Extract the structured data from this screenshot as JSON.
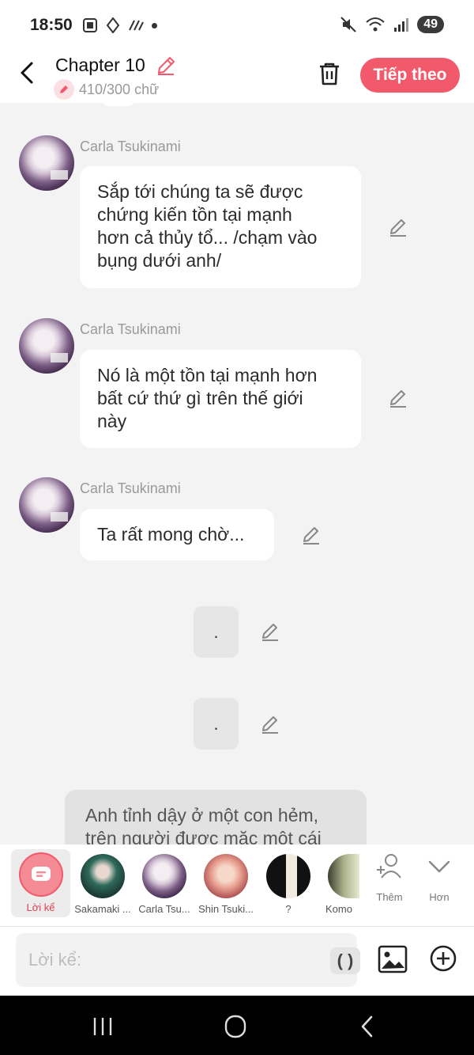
{
  "status": {
    "time": "18:50",
    "battery": "49",
    "left_icons": [
      "screenshot-icon",
      "signal-app-icon",
      "network-icon",
      "dot-icon"
    ],
    "right_icons": [
      "mute-icon",
      "wifi-icon",
      "cell-signal-icon"
    ]
  },
  "header": {
    "title": "Chapter 10",
    "counter": "410/300 chữ",
    "next_label": "Tiếp theo"
  },
  "messages": [
    {
      "sender": "Carla Tsukinami",
      "lines": [
        "Sắp tới chúng ta sẽ được",
        "chứng kiến tồn tại mạnh",
        "hơn cả thủy tổ... /chạm vào",
        "bụng dưới anh/"
      ]
    },
    {
      "sender": "Carla Tsukinami",
      "lines": [
        "Nó là một tồn tại mạnh hơn",
        "bất cứ thứ gì trên thế giới",
        "này"
      ]
    },
    {
      "sender": "Carla Tsukinami",
      "lines": [
        "Ta rất mong chờ..."
      ]
    }
  ],
  "dot_messages": [
    ".",
    "."
  ],
  "narration": {
    "lines": [
      "Anh tỉnh dậy ở một con hẻm,",
      "trên người được mặc một cái"
    ]
  },
  "characters": {
    "narrator": "Lời kể",
    "items": [
      "Sakamaki ...",
      "Carla Tsu...",
      "Shin Tsuki...",
      "?",
      "Komo"
    ],
    "more": "Thêm",
    "collapse": "Hơn"
  },
  "composer": {
    "placeholder": "Lời kể:",
    "paren": "( )"
  },
  "colors": {
    "accent": "#f25a6b",
    "background": "#f3f3f3",
    "bubble": "#ffffff"
  }
}
